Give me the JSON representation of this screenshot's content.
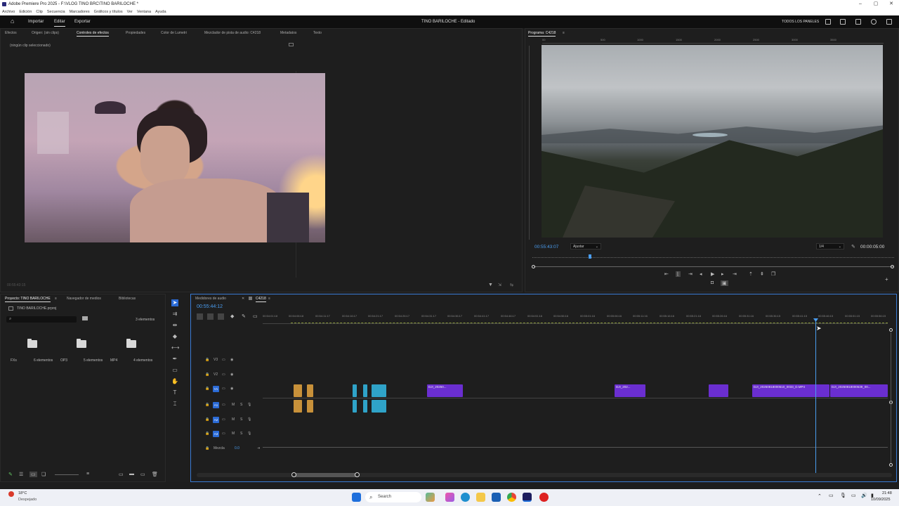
{
  "window": {
    "title": "Adobe Premiere Pro 2025 - F:\\VLOG TINO BRC\\TINO BARILOCHE *"
  },
  "menu": [
    "Archivo",
    "Edición",
    "Clip",
    "Secuencia",
    "Marcadores",
    "Gráficos y títulos",
    "Ver",
    "Ventana",
    "Ayuda"
  ],
  "appbar": {
    "tabs": [
      "Importar",
      "Editar",
      "Exportar"
    ],
    "project_title": "TINO BARILOCHE - Editado",
    "all_panels": "TODOS LOS PANELES"
  },
  "source_panel": {
    "tabs": [
      "Efectos",
      "Origen: (sin clips)",
      "Controles de efectos",
      "Propiedades",
      "Color de Lumetri",
      "Mezclador de pista de audio: C4218",
      "Metadatos",
      "Texto"
    ],
    "status": "(ningún clip seleccionado)",
    "timecode": "00:55:43:15"
  },
  "program": {
    "tab": "Programa: C4218",
    "timecode": "00:55:43:07",
    "fit": "Ajustar",
    "resolution": "1/4",
    "duration": "00:00:05:00",
    "ruler": [
      "00",
      "500",
      "1000",
      "1500",
      "2000",
      "2500",
      "3000",
      "3500"
    ]
  },
  "project": {
    "tabs": [
      "Proyecto: TINO BARILOCHE",
      "Navegador de medios",
      "Bibliotecas"
    ],
    "file": "TINO BARILOCHE.prproj",
    "count": "3 elementos",
    "folders": [
      {
        "name": "FXs",
        "count": "6 elementos"
      },
      {
        "name": "OP3",
        "count": "5 elementos"
      },
      {
        "name": "MP4",
        "count": "4 elementos"
      }
    ]
  },
  "timeline": {
    "tabs": [
      "Medidores de audio",
      "C4218"
    ],
    "timecode": "00:55:44:12",
    "ruler": [
      "00:54:01:18",
      "00:54:06:18",
      "00:54:11:17",
      "00:54:16:17",
      "00:54:21:17",
      "00:54:26:17",
      "00:54:31:17",
      "00:54:36:17",
      "00:54:41:17",
      "00:54:46:17",
      "00:54:51:16",
      "00:54:56:16",
      "00:55:01:16",
      "00:55:06:16",
      "00:55:11:16",
      "00:55:16:16",
      "00:55:21:16",
      "00:55:26:16",
      "00:55:31:16",
      "00:55:36:15",
      "00:55:41:15",
      "00:55:46:15",
      "00:55:51:15",
      "00:55:56:15"
    ],
    "tracks": [
      "V3",
      "V2",
      "V1",
      "A1",
      "A2",
      "A3"
    ],
    "mix_label": "Mezcla",
    "mix_value": "0.0",
    "clips": {
      "c1": "DJI_20250...",
      "c2": "DJI_202...",
      "c3": "DJI_20250818000510_0033_D.MP4",
      "c4": "DJI_20250818000539_00..."
    }
  },
  "taskbar": {
    "weather_temp": "18°C",
    "weather_desc": "Despejado",
    "search": "Search",
    "time": "21:48",
    "date": "10/09/2025"
  }
}
